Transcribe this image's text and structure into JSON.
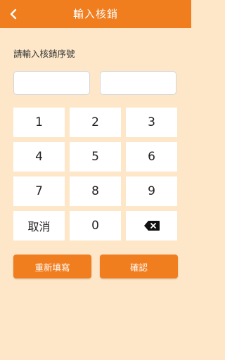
{
  "header": {
    "title": "輸入核銷",
    "back_icon": "chevron-left-icon",
    "background": "#f07d1e"
  },
  "form": {
    "prompt": "請輸入核銷序號",
    "field1_value": "",
    "field2_value": ""
  },
  "keypad": {
    "keys": [
      "1",
      "2",
      "3",
      "4",
      "5",
      "6",
      "7",
      "8",
      "9"
    ],
    "cancel_label": "取消",
    "zero_label": "0",
    "backspace_icon": "backspace-icon"
  },
  "actions": {
    "reset_label": "重新填寫",
    "confirm_label": "確認",
    "accent": "#f07d1e"
  },
  "page": {
    "background": "#fde7c8"
  }
}
